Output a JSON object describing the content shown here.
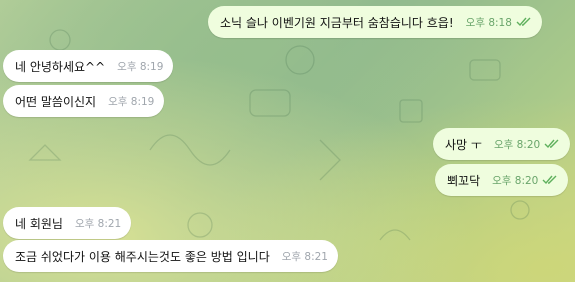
{
  "messages": [
    {
      "text": "소닉 슬나 이벤기원  지금부터 숨참습니다 흐읍!",
      "time": "오후 8:18",
      "direction": "out"
    },
    {
      "text": "네 안녕하세요^^",
      "time": "오후 8:19",
      "direction": "in"
    },
    {
      "text": "어떤 말씀이신지",
      "time": "오후 8:19",
      "direction": "in"
    },
    {
      "text": "사망 ㅜ",
      "time": "오후 8:20",
      "direction": "out"
    },
    {
      "text": "뾔꼬닥",
      "time": "오후 8:20",
      "direction": "out"
    },
    {
      "text": "네 회원님",
      "time": "오후 8:21",
      "direction": "in"
    },
    {
      "text": "조금 쉬었다가 이용 해주시는것도 좋은 방법 입니다",
      "time": "오후 8:21",
      "direction": "in"
    }
  ],
  "icons": {
    "read_receipt": "double-check-icon"
  },
  "colors": {
    "incoming_bubble": "#ffffff",
    "outgoing_bubble": "#effdde",
    "check": "#5fb05d"
  }
}
